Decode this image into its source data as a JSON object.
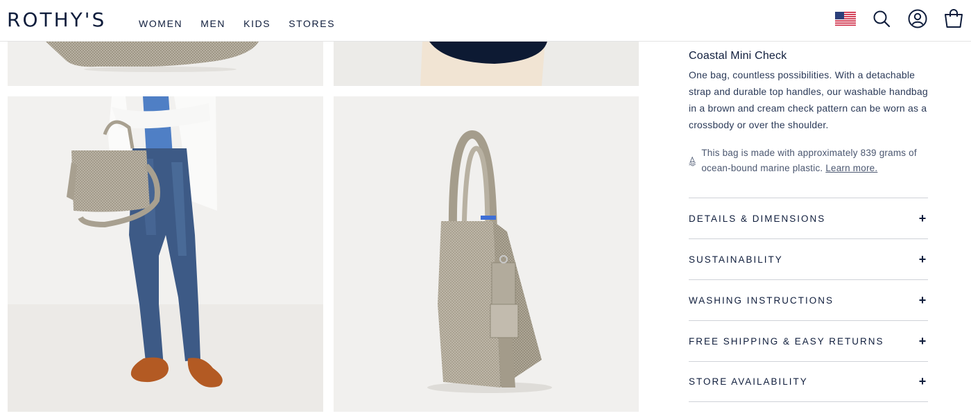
{
  "header": {
    "logo": "ROTHY'S",
    "nav": [
      "WOMEN",
      "MEN",
      "KIDS",
      "STORES"
    ]
  },
  "icons": {
    "flag": "us-flag-icon",
    "search": "search-icon",
    "account": "account-icon",
    "cart": "shopping-bag-icon"
  },
  "product": {
    "name": "Coastal Mini Check",
    "description": "One bag, countless possibilities. With a detachable strap and durable top handles, our washable handbag in a brown and cream check pattern can be worn as a crossbody or over the shoulder.",
    "eco_text": "This bag is made with approximately 839 grams of ocean-bound marine plastic.",
    "eco_link": "Learn more."
  },
  "accordion": [
    {
      "label": "DETAILS & DIMENSIONS",
      "toggle": "+"
    },
    {
      "label": "SUSTAINABILITY",
      "toggle": "+"
    },
    {
      "label": "WASHING INSTRUCTIONS",
      "toggle": "+"
    },
    {
      "label": "FREE SHIPPING & EASY RETURNS",
      "toggle": "+"
    },
    {
      "label": "STORE AVAILABILITY",
      "toggle": "+"
    }
  ],
  "colors": {
    "navy": "#0f1d3c",
    "bag": "#b2ab9c",
    "denim": "#3d5a86",
    "shoe": "#b35a23"
  }
}
